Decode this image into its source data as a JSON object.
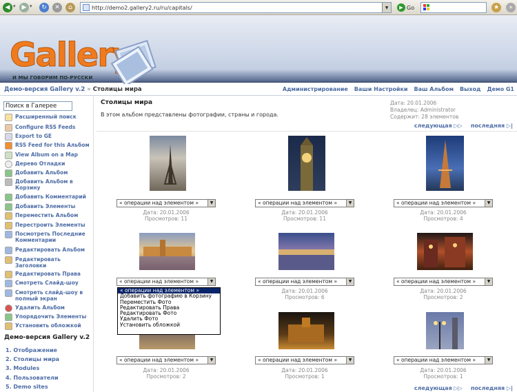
{
  "browser": {
    "url": "http://demo2.gallery2.ru/ru/capitals/",
    "go_label": "Go"
  },
  "logo": {
    "word": "Gallery",
    "tagline": "И МЫ ГОВОРИМ ПО-РУССКИ"
  },
  "breadcrumb": {
    "root": "Демо-версия Gallery v.2",
    "separator": "»",
    "current": "Столицы мира"
  },
  "top_nav": [
    "Администрирование",
    "Ваши Настройки",
    "Ваш Альбом",
    "Выход",
    "Демо G1"
  ],
  "sidebar": {
    "search_value": "Поиск в Галерее",
    "items": [
      {
        "label": "Расширенный поиск",
        "icon": "magnifier-icon"
      },
      {
        "label": "Configure RSS Feeds",
        "icon": "rss-config-icon"
      },
      {
        "label": "Export to GE",
        "icon": "export-icon"
      },
      {
        "label": "RSS Feed for this Альбом",
        "icon": "rss-icon"
      },
      {
        "label": "View Album on a Map",
        "icon": "map-icon"
      },
      {
        "label": "Дерево Отладки",
        "icon": "bug-icon"
      },
      {
        "label": "Добавить Альбом",
        "icon": "add-album-icon"
      },
      {
        "label": "Добавить Альбом в Корзину",
        "icon": "cart-icon"
      },
      {
        "label": "Добавить Комментарий",
        "icon": "comment-icon"
      },
      {
        "label": "Добавить Элементы",
        "icon": "add-items-icon"
      },
      {
        "label": "Переместить Альбом",
        "icon": "move-icon"
      },
      {
        "label": "Перестроить Элементы",
        "icon": "arrange-icon"
      },
      {
        "label": "Посмотреть Последние Комментарии",
        "icon": "comments-icon"
      },
      {
        "label": "Редактировать Альбом",
        "icon": "edit-album-icon"
      },
      {
        "label": "Редактировать Заголовки",
        "icon": "edit-captions-icon"
      },
      {
        "label": "Редактировать Права",
        "icon": "permissions-icon"
      },
      {
        "label": "Смотреть Слайд-шоу",
        "icon": "slideshow-icon"
      },
      {
        "label": "Смотреть слайд-шоу в полный экран",
        "icon": "fullscreen-icon"
      },
      {
        "label": "Удалить Альбом",
        "icon": "delete-icon"
      },
      {
        "label": "Упорядочить Элементы",
        "icon": "sort-icon"
      },
      {
        "label": "Установить обложкой",
        "icon": "thumbnail-icon"
      }
    ],
    "section_title": "Демо-версия Gallery v.2",
    "nav": [
      "1. Отображение",
      "2. Столицы мира",
      "3. Modules",
      "4. Пользователи",
      "5. Demo sites"
    ]
  },
  "album": {
    "title": "Столицы мира",
    "description": "В этом альбом представлены фотографии, страны и города.",
    "meta": [
      "Дата: 20.01.2006",
      "Владелец: Administrator",
      "Содержит: 28 элементов"
    ]
  },
  "pager": {
    "next": "следующая",
    "last": "последняя"
  },
  "item_select_label": "« операции над элементом »",
  "items": [
    {
      "date": "Дата: 20.01.2006",
      "views": "Просмотров: 11"
    },
    {
      "date": "Дата: 20.01.2006",
      "views": "Просмотров: 11"
    },
    {
      "date": "Дата: 20.01.2006",
      "views": "Просмотров: 4"
    },
    {
      "date": "",
      "views": ""
    },
    {
      "date": "Дата: 20.01.2006",
      "views": "Просмотров: 6"
    },
    {
      "date": "Дата: 20.01.2006",
      "views": "Просмотров: 2"
    },
    {
      "date": "Дата: 20.01.2006",
      "views": "Просмотров: 2"
    },
    {
      "date": "Дата: 20.01.2006",
      "views": "Просмотров: 1"
    },
    {
      "date": "Дата: 20.01.2006",
      "views": "Просмотров: 1"
    }
  ],
  "dropdown_options": [
    "« операции над элементом »",
    "Добавить фотографию в Корзину",
    "Переместить Фото",
    "Редактировать Права",
    "Редактировать Фото",
    "Удалить Фото",
    "Установить обложкой"
  ]
}
